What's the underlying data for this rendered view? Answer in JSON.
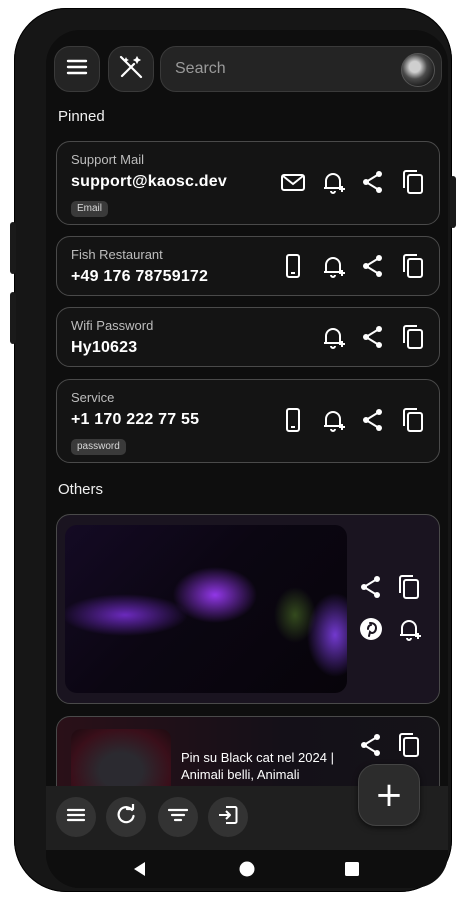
{
  "top_bar": {
    "search_placeholder": "Search"
  },
  "sections": {
    "pinned_title": "Pinned",
    "others_title": "Others"
  },
  "pinned": [
    {
      "label": "Support Mail",
      "value": "support@kaosc.dev",
      "tag": "Email",
      "icon": "mail-icon"
    },
    {
      "label": "Fish Restaurant",
      "value": "+49 176 78759172",
      "tag": "",
      "icon": "phone-icon"
    },
    {
      "label": "Wifi Password",
      "value": "Hy10623",
      "tag": "",
      "icon": ""
    },
    {
      "label": "Service",
      "value": "+1 170 222 77 55",
      "tag": "password",
      "icon": "phone-icon"
    }
  ],
  "others": [
    {
      "type": "image"
    },
    {
      "type": "link",
      "title": "Pin su Black cat nel 2024 | Animali belli, Animali"
    }
  ],
  "bottom_bar": {
    "buttons": [
      "menu-icon",
      "refresh-icon",
      "filter-icon",
      "login-icon"
    ],
    "fab": "+"
  },
  "colors": {
    "background": "#0e0e0e",
    "card_border": "#4a4a4a",
    "accent_purple": "#8a3cff"
  }
}
